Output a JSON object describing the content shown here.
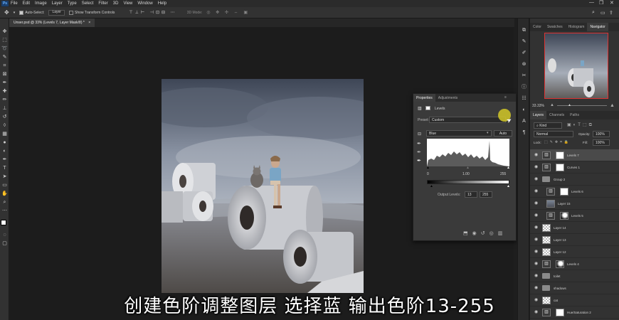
{
  "menubar": {
    "items": [
      "File",
      "Edit",
      "Image",
      "Layer",
      "Type",
      "Select",
      "Filter",
      "3D",
      "View",
      "Window",
      "Help"
    ],
    "window_controls": [
      "—",
      "❐",
      "✕"
    ]
  },
  "options_bar": {
    "auto_select_label": "Auto-Select:",
    "auto_select_value": "Layer",
    "show_transform_label": "Show Transform Controls",
    "mode_label": "3D Mode:"
  },
  "document_tab": {
    "title": "Unser.psd @ 33% (Levels 7, Layer Mask/8) *",
    "close": "×"
  },
  "panel_tabs": {
    "top": [
      "Color",
      "Swatches",
      "Histogram",
      "Navigator"
    ],
    "active_top": "Navigator"
  },
  "navigator": {
    "zoom": "33.33%"
  },
  "layers_panel": {
    "tabs": [
      "Layers",
      "Channels",
      "Paths"
    ],
    "kind_label": "Kind",
    "blend_mode": "Normal",
    "opacity_label": "Opacity:",
    "opacity_value": "100%",
    "lock_label": "Lock:",
    "fill_label": "Fill:",
    "fill_value": "100%",
    "layers": [
      {
        "name": "Levels 7",
        "thumb": "adj",
        "mask": "white",
        "selected": true,
        "indent": false
      },
      {
        "name": "Curves 1",
        "thumb": "adj",
        "mask": "white",
        "selected": false,
        "indent": false
      },
      {
        "name": "Group 2",
        "thumb": "folder",
        "mask": "none",
        "selected": false,
        "indent": false
      },
      {
        "name": "Levels 6",
        "thumb": "adj",
        "mask": "white",
        "selected": false,
        "indent": true
      },
      {
        "name": "Layer 15",
        "thumb": "pic",
        "mask": "none",
        "selected": false,
        "indent": true
      },
      {
        "name": "Levels 5",
        "thumb": "adj",
        "mask": "dark",
        "selected": false,
        "indent": true
      },
      {
        "name": "Layer 14",
        "thumb": "checker",
        "mask": "none",
        "selected": false,
        "indent": false
      },
      {
        "name": "Layer 13",
        "thumb": "checker",
        "mask": "none",
        "selected": false,
        "indent": false
      },
      {
        "name": "Layer 12",
        "thumb": "checker",
        "mask": "none",
        "selected": false,
        "indent": false
      },
      {
        "name": "Levels 4",
        "thumb": "adj",
        "mask": "dark",
        "selected": false,
        "indent": false
      },
      {
        "name": "toilet",
        "thumb": "folder",
        "mask": "none",
        "selected": false,
        "indent": false
      },
      {
        "name": "shadows",
        "thumb": "folder",
        "mask": "none",
        "selected": false,
        "indent": false
      },
      {
        "name": "cat",
        "thumb": "checker",
        "mask": "none",
        "selected": false,
        "indent": false
      },
      {
        "name": "Hue/Saturation 2",
        "thumb": "adj",
        "mask": "white",
        "selected": false,
        "indent": false
      }
    ]
  },
  "properties": {
    "tabs": [
      "Properties",
      "Adjustments"
    ],
    "type_label": "Levels",
    "preset_label": "Preset:",
    "preset_value": "Custom",
    "channel_value": "Blue",
    "auto_label": "Auto",
    "input_black": "0",
    "input_gamma": "1.00",
    "input_white": "255",
    "output_label": "Output Levels:",
    "output_black": "13",
    "output_white": "255"
  },
  "subtitle": "创建色阶调整图层 选择蓝 输出色阶13-255"
}
